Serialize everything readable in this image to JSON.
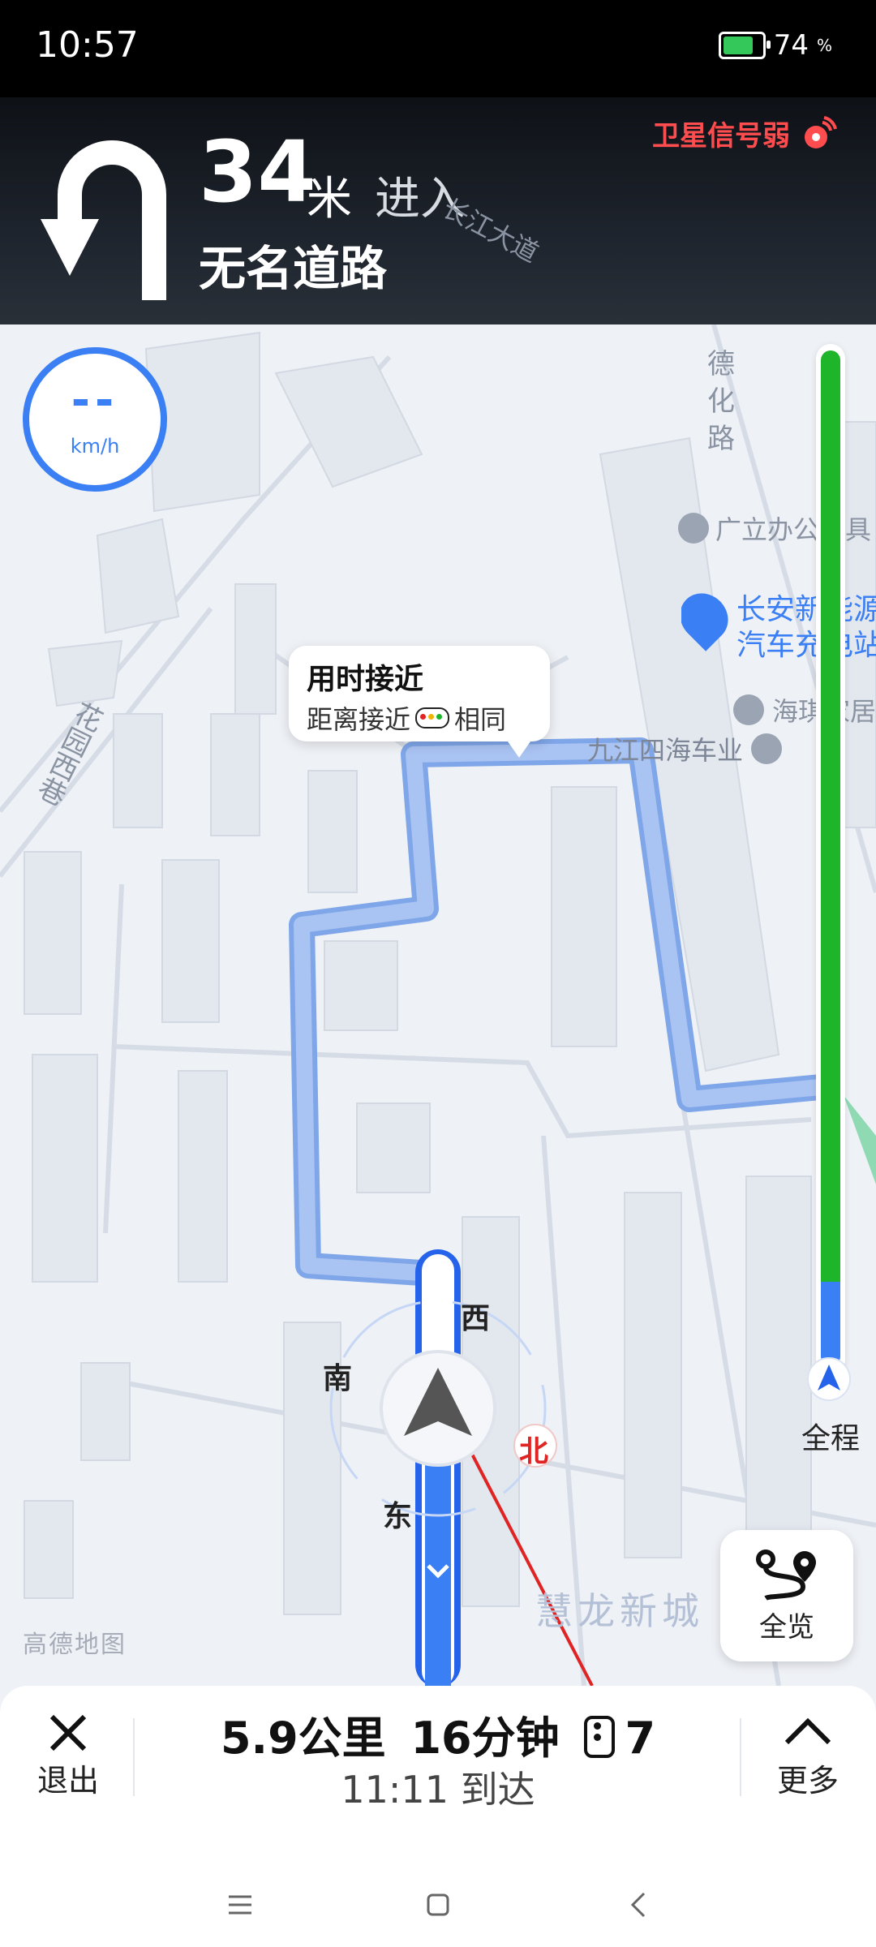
{
  "status_bar": {
    "time": "10:57",
    "battery": "74"
  },
  "guidance": {
    "distance": "34",
    "unit": "米",
    "action": "进入",
    "road": "无名道路",
    "gps_warning": "卫星信号弱"
  },
  "speed": {
    "value": "--",
    "unit": "km/h"
  },
  "map": {
    "logo": "高德地图",
    "labels": {
      "dehua_road": "德化路",
      "changjiang_ave": "长江大道",
      "huayuan_west_lane": "花园西巷",
      "guangli": "广立办公家具",
      "changan_1": "长安新能源",
      "changan_2": "汽车充电站",
      "haiqi": "海琪家居",
      "jiujiang": "九江四海车业",
      "huilong": "慧龙新城"
    },
    "compass": {
      "north": "北",
      "south": "南",
      "east": "东",
      "west": "西"
    }
  },
  "route_bubble": {
    "title": "用时接近",
    "subtitle_left": "距离接近",
    "subtitle_right": "相同"
  },
  "progress": {
    "label": "全程",
    "completed_fraction": 0.08
  },
  "overview_button": {
    "label": "全览"
  },
  "bottom": {
    "exit_label": "退出",
    "distance": "5.9公里",
    "duration": "16分钟",
    "traffic_lights": "7",
    "arrival_time": "11:11",
    "arrival_label": "到达",
    "more_label": "更多"
  },
  "colors": {
    "route": "#9ab8f2",
    "active_route": "#3b7ff5",
    "progress_green": "#1eb52a",
    "warning": "#ff4d4f"
  }
}
